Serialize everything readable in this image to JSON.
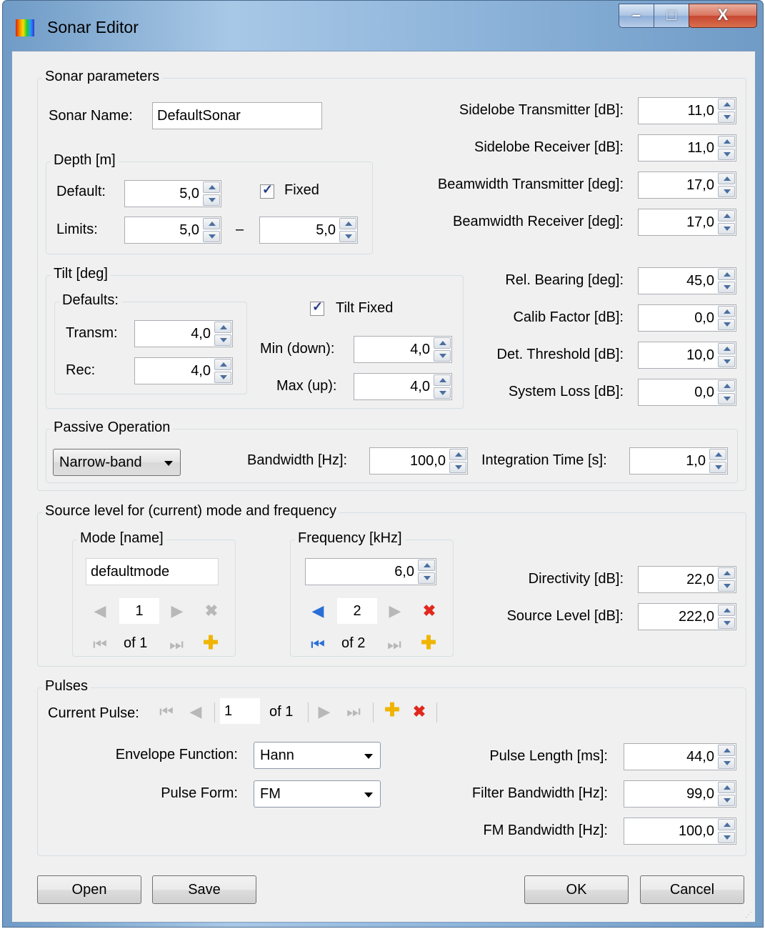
{
  "window": {
    "title": "Sonar Editor",
    "minimize": "–",
    "maximize": "□",
    "close": "X"
  },
  "sonar_params": {
    "legend": "Sonar parameters",
    "name_label": "Sonar Name:",
    "name_value": "DefaultSonar",
    "depth": {
      "legend": "Depth [m]",
      "default_label": "Default:",
      "default_value": "5,0",
      "fixed_label": "Fixed",
      "limits_label": "Limits:",
      "limit_min": "5,0",
      "dash": "–",
      "limit_max": "5,0"
    },
    "tilt": {
      "legend": "Tilt [deg]",
      "defaults_legend": "Defaults:",
      "transm_label": "Transm:",
      "transm_value": "4,0",
      "rec_label": "Rec:",
      "rec_value": "4,0",
      "tilt_fixed_label": "Tilt Fixed",
      "min_label": "Min (down):",
      "min_value": "4,0",
      "max_label": "Max (up):",
      "max_value": "4,0"
    },
    "right": [
      {
        "label": "Sidelobe Transmitter [dB]:",
        "value": "11,0"
      },
      {
        "label": "Sidelobe Receiver [dB]:",
        "value": "11,0"
      },
      {
        "label": "Beamwidth Transmitter [deg]:",
        "value": "17,0"
      },
      {
        "label": "Beamwidth Receiver [deg]:",
        "value": "17,0"
      },
      {
        "label": "Rel. Bearing [deg]:",
        "value": "45,0"
      },
      {
        "label": "Calib Factor [dB]:",
        "value": "0,0"
      },
      {
        "label": "Det. Threshold [dB]:",
        "value": "10,0"
      },
      {
        "label": "System Loss [dB]:",
        "value": "0,0"
      }
    ],
    "passive": {
      "legend": "Passive Operation",
      "mode": "Narrow-band",
      "bandwidth_label": "Bandwidth [Hz]:",
      "bandwidth_value": "100,0",
      "integration_label": "Integration Time [s]:",
      "integration_value": "1,0"
    }
  },
  "source_level": {
    "legend": "Source level for (current) mode and frequency",
    "mode": {
      "legend": "Mode [name]",
      "name": "defaultmode",
      "index": "1",
      "of": "of 1"
    },
    "frequency": {
      "legend": "Frequency [kHz]",
      "value": "6,0",
      "index": "2",
      "of": "of 2"
    },
    "directivity_label": "Directivity [dB]:",
    "directivity_value": "22,0",
    "source_level_label": "Source Level [dB]:",
    "source_level_value": "222,0"
  },
  "pulses": {
    "legend": "Pulses",
    "current_label": "Current Pulse:",
    "current_index": "1",
    "of": "of 1",
    "envelope_label": "Envelope Function:",
    "envelope_value": "Hann",
    "pulse_form_label": "Pulse Form:",
    "pulse_form_value": "FM",
    "pulse_length_label": "Pulse Length [ms]:",
    "pulse_length_value": "44,0",
    "filter_bw_label": "Filter Bandwidth [Hz]:",
    "filter_bw_value": "99,0",
    "fm_bw_label": "FM Bandwidth [Hz]:",
    "fm_bw_value": "100,0"
  },
  "buttons": {
    "open": "Open",
    "save": "Save",
    "ok": "OK",
    "cancel": "Cancel"
  },
  "icons": {
    "first": "⏮",
    "prev": "◀",
    "next": "▶",
    "last": "⏭",
    "add": "✚",
    "delete": "✖"
  }
}
